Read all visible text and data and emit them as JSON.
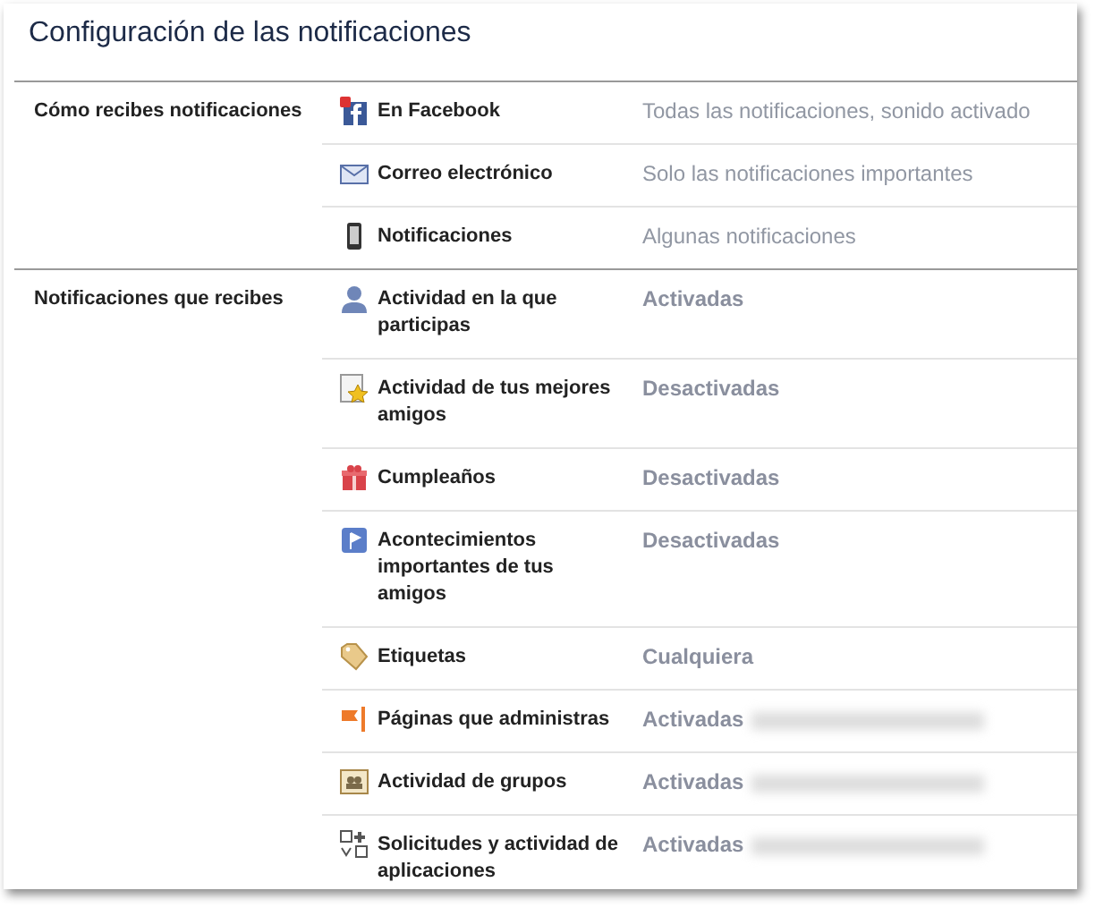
{
  "title": "Configuración de las notificaciones",
  "sections": [
    {
      "label": "Cómo recibes notificaciones",
      "kind": "channels",
      "items": [
        {
          "kind": "facebook",
          "label": "En Facebook",
          "value": "Todas las notificaciones, sonido activado"
        },
        {
          "kind": "mail",
          "label": "Correo electrónico",
          "value": "Solo las notificaciones importantes"
        },
        {
          "kind": "phone",
          "label": "Notificaciones",
          "value": "Algunas notificaciones"
        }
      ]
    },
    {
      "label": "Notificaciones que recibes",
      "kind": "types",
      "items": [
        {
          "kind": "person",
          "label": "Actividad en la que participas",
          "value": "Activadas"
        },
        {
          "kind": "star",
          "label": "Actividad de tus mejores amigos",
          "value": "Desactivadas"
        },
        {
          "kind": "gift",
          "label": "Cumpleaños",
          "value": "Desactivadas"
        },
        {
          "kind": "flag",
          "label": "Acontecimientos importantes de tus amigos",
          "value": "Desactivadas"
        },
        {
          "kind": "tag",
          "label": "Etiquetas",
          "value": "Cualquiera"
        },
        {
          "kind": "pages",
          "label": "Páginas que administras",
          "value": "Activadas",
          "blurred": true
        },
        {
          "kind": "group",
          "label": "Actividad de grupos",
          "value": "Activadas",
          "blurred": true
        },
        {
          "kind": "apps",
          "label": "Solicitudes y actividad de aplicaciones",
          "value": "Activadas",
          "blurred": true
        }
      ]
    }
  ]
}
